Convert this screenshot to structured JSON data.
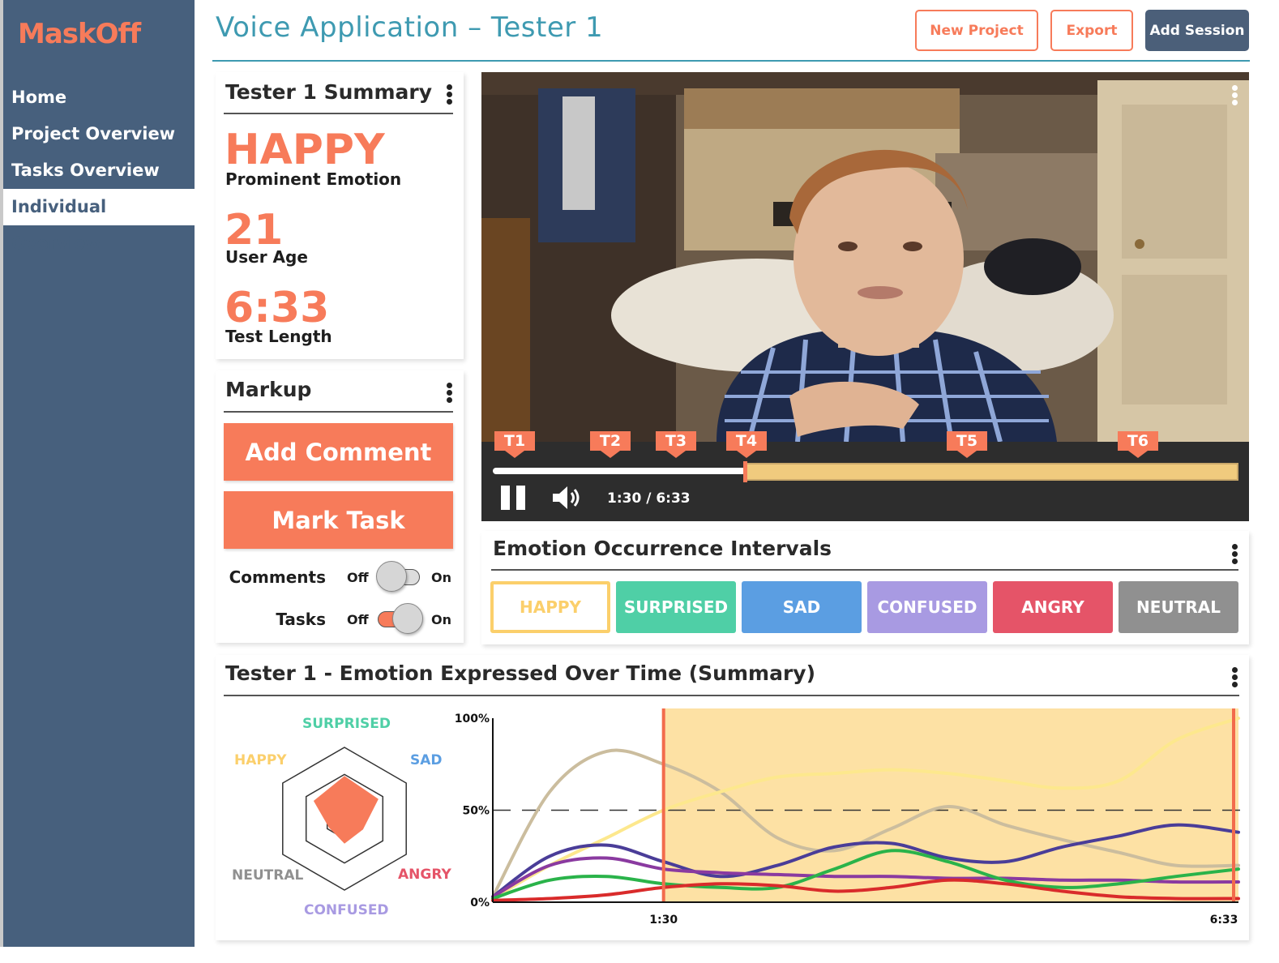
{
  "app": {
    "logo": "MaskOff",
    "title": "Voice Application – Tester 1"
  },
  "nav": {
    "items": [
      {
        "label": "Home",
        "active": false
      },
      {
        "label": "Project Overview",
        "active": false
      },
      {
        "label": "Tasks Overview",
        "active": false
      },
      {
        "label": "Individual Overview",
        "active": true
      }
    ]
  },
  "header": {
    "new_project": "New Project",
    "export": "Export",
    "add_session": "Add Session"
  },
  "summary": {
    "title": "Tester 1 Summary",
    "emotion_value": "HAPPY",
    "emotion_label": "Prominent Emotion",
    "age_value": "21",
    "age_label": "User Age",
    "length_value": "6:33",
    "length_label": "Test Length"
  },
  "markup": {
    "title": "Markup",
    "add_comment": "Add Comment",
    "mark_task": "Mark Task",
    "comments_label": "Comments",
    "tasks_label": "Tasks",
    "off": "Off",
    "on": "On",
    "comments_on": false,
    "tasks_on": true
  },
  "video": {
    "markers": [
      "T1",
      "T2",
      "T3",
      "T4",
      "T5",
      "T6"
    ],
    "time": "1:30 / 6:33",
    "progress": 0.229
  },
  "intervals": {
    "title": "Emotion Occurrence Intervals",
    "emotions": [
      {
        "label": "HAPPY",
        "color": "#fbcf6b",
        "selected": true
      },
      {
        "label": "SURPRISED",
        "color": "#4fcfa6",
        "selected": false
      },
      {
        "label": "SAD",
        "color": "#5b9ee2",
        "selected": false
      },
      {
        "label": "CONFUSED",
        "color": "#a89ae2",
        "selected": false
      },
      {
        "label": "ANGRY",
        "color": "#e55468",
        "selected": false
      },
      {
        "label": "NEUTRAL",
        "color": "#909090",
        "selected": false
      }
    ]
  },
  "over_time": {
    "title": "Tester 1 - Emotion Expressed Over Time (Summary)",
    "radar_labels": {
      "surprised": "SURPRISED",
      "sad": "SAD",
      "angry": "ANGRY",
      "confused": "CONFUSED",
      "neutral": "NEUTRAL",
      "happy": "HAPPY"
    }
  },
  "chart_data": [
    {
      "type": "radar",
      "axes": [
        "SURPRISED",
        "SAD",
        "ANGRY",
        "CONFUSED",
        "NEUTRAL",
        "HAPPY"
      ],
      "values": [
        0.6,
        0.55,
        0.3,
        0.35,
        0.25,
        0.5
      ],
      "color": "#f77b5a"
    },
    {
      "type": "line",
      "yticks": [
        "100%",
        "50%",
        "0%"
      ],
      "xticks": [
        "1:30",
        "6:33"
      ],
      "ylim": [
        0,
        100
      ],
      "xlim": [
        0,
        393
      ],
      "reference_line": 50,
      "highlight": {
        "from": 90,
        "to": 393,
        "color": "#fde1a4"
      },
      "series": [
        {
          "color": "#cbbd9e",
          "x": [
            0,
            30,
            60,
            90,
            120,
            150,
            180,
            210,
            240,
            270,
            300,
            330,
            360,
            393
          ],
          "y": [
            3,
            60,
            82,
            75,
            60,
            35,
            28,
            40,
            52,
            42,
            34,
            27,
            20,
            20
          ]
        },
        {
          "color": "#fde88d",
          "x": [
            0,
            30,
            60,
            90,
            120,
            150,
            180,
            210,
            240,
            270,
            300,
            330,
            360,
            393
          ],
          "y": [
            2,
            20,
            35,
            50,
            60,
            68,
            70,
            72,
            70,
            66,
            62,
            66,
            88,
            100
          ]
        },
        {
          "color": "#4a3d98",
          "x": [
            0,
            30,
            60,
            90,
            120,
            150,
            180,
            210,
            240,
            270,
            300,
            330,
            360,
            393
          ],
          "y": [
            3,
            25,
            31,
            22,
            14,
            20,
            30,
            32,
            24,
            22,
            30,
            36,
            42,
            38
          ]
        },
        {
          "color": "#8a3aa0",
          "x": [
            0,
            30,
            60,
            90,
            120,
            150,
            180,
            210,
            240,
            270,
            300,
            330,
            360,
            393
          ],
          "y": [
            3,
            20,
            24,
            18,
            16,
            15,
            14,
            14,
            13,
            13,
            12,
            12,
            11,
            11
          ]
        },
        {
          "color": "#2ab34a",
          "x": [
            0,
            30,
            60,
            90,
            120,
            150,
            180,
            210,
            240,
            270,
            300,
            330,
            360,
            393
          ],
          "y": [
            2,
            12,
            14,
            10,
            8,
            8,
            18,
            28,
            22,
            12,
            8,
            10,
            14,
            18
          ]
        },
        {
          "color": "#d92b2b",
          "x": [
            0,
            30,
            60,
            90,
            120,
            150,
            180,
            210,
            240,
            270,
            300,
            330,
            360,
            393
          ],
          "y": [
            1,
            2,
            4,
            8,
            10,
            9,
            6,
            8,
            12,
            10,
            6,
            3,
            2,
            2
          ]
        }
      ]
    }
  ]
}
